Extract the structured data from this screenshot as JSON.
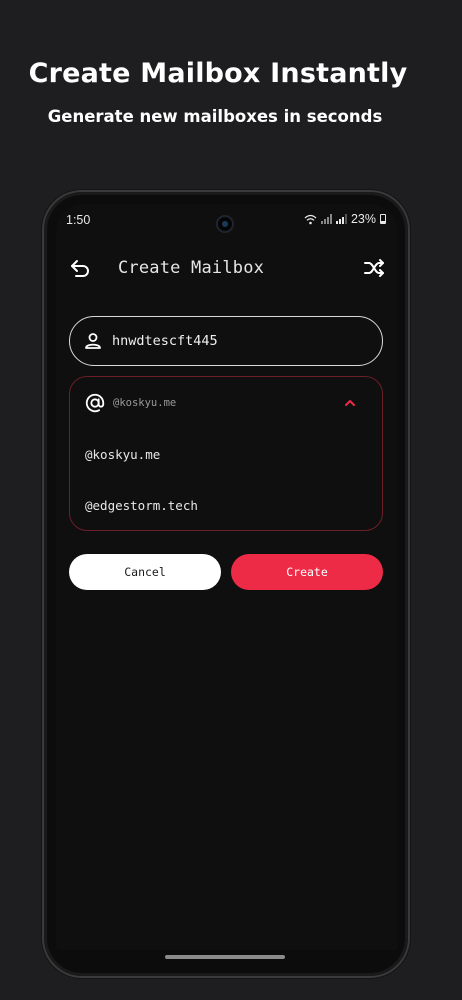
{
  "promo": {
    "title": "Create Mailbox Instantly",
    "subtitle": "Generate new mailboxes in seconds"
  },
  "status_bar": {
    "time": "1:50",
    "battery": "23%"
  },
  "app_bar": {
    "title": "Create Mailbox",
    "back_icon": "back-arrow-icon",
    "action_icon": "shuffle-icon"
  },
  "form": {
    "username_value": "hnwdtescft445",
    "username_icon": "person-icon",
    "domain_icon": "at-icon",
    "domain_selected": "@koskyu.me",
    "domain_options": [
      "@koskyu.me",
      "@edgestorm.tech"
    ],
    "cancel_label": "Cancel",
    "create_label": "Create"
  },
  "colors": {
    "accent": "#ee2b47",
    "background": "#0f0f10",
    "dropdown_border": "#6b1e28"
  }
}
